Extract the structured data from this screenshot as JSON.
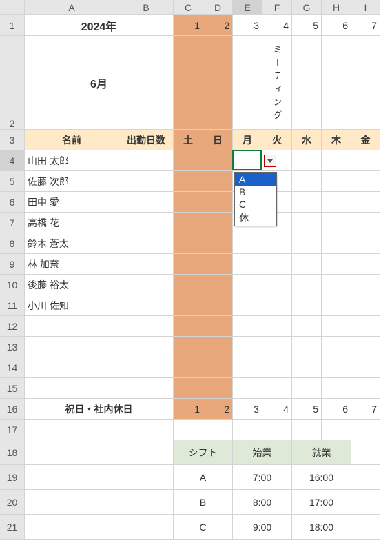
{
  "columns": [
    "A",
    "B",
    "C",
    "D",
    "E",
    "F",
    "G",
    "H",
    "I"
  ],
  "rows": [
    "1",
    "2",
    "3",
    "4",
    "5",
    "6",
    "7",
    "8",
    "9",
    "10",
    "11",
    "12",
    "13",
    "14",
    "15",
    "16",
    "17",
    "18",
    "19",
    "20",
    "21"
  ],
  "header": {
    "year": "2024年",
    "month": "6月",
    "days": [
      "1",
      "2",
      "3",
      "4",
      "5",
      "6",
      "7"
    ],
    "meeting": "ミーティング",
    "name_label": "名前",
    "attend_label": "出勤日数",
    "weekdays": [
      "土",
      "日",
      "月",
      "火",
      "水",
      "木",
      "金"
    ]
  },
  "names": [
    "山田 太郎",
    "佐藤 次郎",
    "田中 愛",
    "高橋 花",
    "鈴木 蒼太",
    "林 加奈",
    "後藤 裕太",
    "小川 佐知"
  ],
  "row16_label": "祝日・社内休日",
  "row16_days": [
    "1",
    "2",
    "3",
    "4",
    "5",
    "6",
    "7"
  ],
  "shift_table": {
    "headers": [
      "シフト",
      "始業",
      "就業"
    ],
    "rows": [
      [
        "A",
        "7:00",
        "16:00"
      ],
      [
        "B",
        "8:00",
        "17:00"
      ],
      [
        "C",
        "9:00",
        "18:00"
      ]
    ]
  },
  "dropdown": {
    "options": [
      "A",
      "B",
      "C",
      "休"
    ],
    "selected": "A"
  }
}
